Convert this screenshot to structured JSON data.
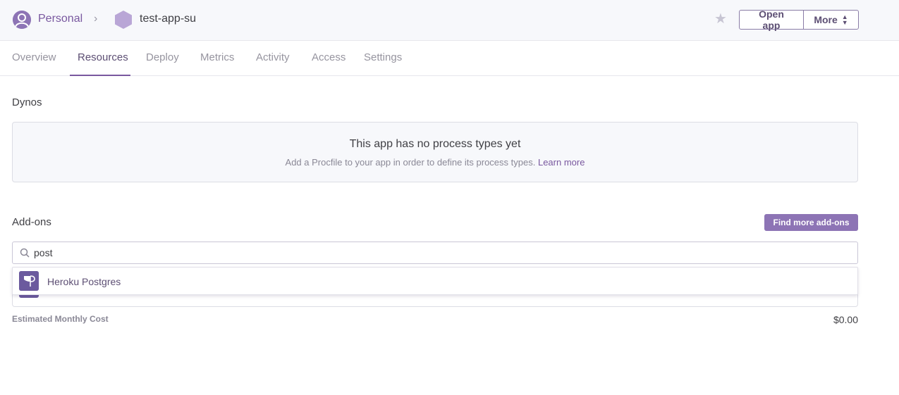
{
  "header": {
    "account_label": "Personal",
    "app_name": "test-app-su",
    "open_app_label": "Open app",
    "more_label": "More",
    "accent_color": "#79589f"
  },
  "tabs": [
    {
      "label": "Overview"
    },
    {
      "label": "Resources",
      "active": true
    },
    {
      "label": "Deploy"
    },
    {
      "label": "Metrics"
    },
    {
      "label": "Activity"
    },
    {
      "label": "Access"
    },
    {
      "label": "Settings"
    }
  ],
  "dynos": {
    "title": "Dynos",
    "empty_heading": "This app has no process types yet",
    "empty_text": "Add a Procfile to your app in order to define its process types.",
    "learn_more": "Learn more"
  },
  "addons": {
    "title": "Add-ons",
    "find_more_label": "Find more add-ons",
    "search_value": "post",
    "suggestions": [
      {
        "name": "Heroku Postgres",
        "icon": "heroku-postgres-icon"
      }
    ],
    "cost_label": "Estimated Monthly Cost",
    "cost_value": "$0.00"
  }
}
